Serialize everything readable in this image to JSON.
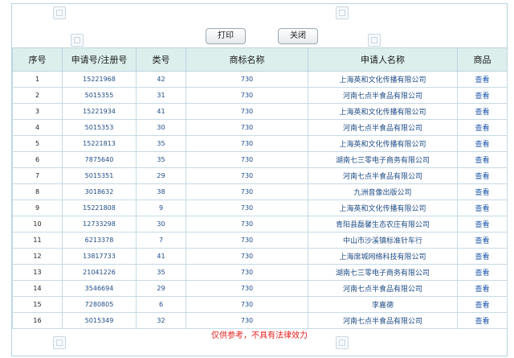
{
  "toolbar": {
    "print_label": "打印",
    "close_label": "关闭"
  },
  "table": {
    "headers": [
      "序号",
      "申请号/注册号",
      "类号",
      "商标名称",
      "申请人名称",
      "商品"
    ],
    "rows": [
      [
        "1",
        "15221968",
        "42",
        "730",
        "上海英和文化传播有限公司",
        "查看"
      ],
      [
        "2",
        "5015355",
        "31",
        "730",
        "河南七点半食品有限公司",
        "查看"
      ],
      [
        "3",
        "15221934",
        "41",
        "730",
        "上海英和文化传播有限公司",
        "查看"
      ],
      [
        "4",
        "5015353",
        "30",
        "730",
        "河南七点半食品有限公司",
        "查看"
      ],
      [
        "5",
        "15221813",
        "35",
        "730",
        "上海英和文化传播有限公司",
        "查看"
      ],
      [
        "6",
        "7875640",
        "35",
        "730",
        "湖南七三零电子商务有限公司",
        "查看"
      ],
      [
        "7",
        "5015351",
        "29",
        "730",
        "河南七点半食品有限公司",
        "查看"
      ],
      [
        "8",
        "3018632",
        "38",
        "730",
        "九洲音像出版公司",
        "查看"
      ],
      [
        "9",
        "15221808",
        "9",
        "730",
        "上海英和文化传播有限公司",
        "查看"
      ],
      [
        "10",
        "12733298",
        "30",
        "730",
        "青阳县磊馨生态农庄有限公司",
        "查看"
      ],
      [
        "11",
        "6213378",
        "7",
        "730",
        "中山市沙溪镇标准针车行",
        "查看"
      ],
      [
        "12",
        "13817733",
        "41",
        "730",
        "上海席城网络科技有限公司",
        "查看"
      ],
      [
        "13",
        "21041226",
        "35",
        "730",
        "湖南七三零电子商务有限公司",
        "查看"
      ],
      [
        "14",
        "3546694",
        "29",
        "730",
        "河南七点半食品有限公司",
        "查看"
      ],
      [
        "15",
        "7280805",
        "6",
        "730",
        "李嘉德",
        "查看"
      ],
      [
        "16",
        "5015349",
        "32",
        "730",
        "河南七点半食品有限公司",
        "查看"
      ]
    ]
  },
  "footer": {
    "note": "仅供参考，不具有法律效力"
  },
  "colors": {
    "header_bg": "#dcefed",
    "link": "#1f4c85",
    "note": "#e0201c"
  }
}
